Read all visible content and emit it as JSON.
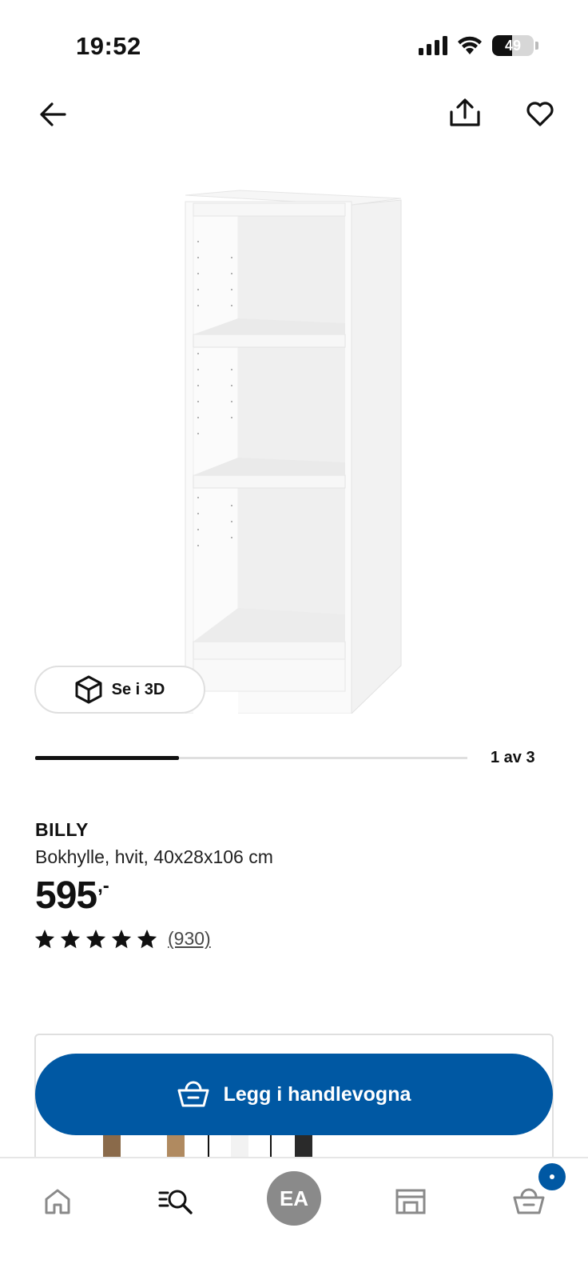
{
  "status_bar": {
    "time": "19:52",
    "battery_percent": "49",
    "battery_level": 0.49,
    "icons": [
      "signal-icon",
      "wifi-icon",
      "battery-icon"
    ]
  },
  "header": {
    "icons": [
      "back-arrow-icon",
      "share-icon",
      "heart-icon"
    ]
  },
  "gallery": {
    "view_3d_label": "Se i 3D",
    "view_3d_icon": "cube-icon",
    "position_label": "1 av 3",
    "current_index": 1,
    "total_images": 3
  },
  "product": {
    "name": "BILLY",
    "description": "Bokhylle, hvit, 40x28x106 cm",
    "price": "595",
    "price_suffix": ",-",
    "rating": 5,
    "rating_max": 5,
    "review_count": "(930)"
  },
  "cart_action": {
    "label": "Legg i handlevogna",
    "icon": "basket-icon"
  },
  "bottom_nav": {
    "items": [
      {
        "name": "home",
        "icon": "home-icon"
      },
      {
        "name": "search",
        "icon": "search-list-icon"
      },
      {
        "name": "profile",
        "label": "EA"
      },
      {
        "name": "store",
        "icon": "store-icon"
      },
      {
        "name": "cart",
        "icon": "basket-icon"
      }
    ]
  },
  "colors": {
    "brand_blue": "#0058a3",
    "text": "#111111",
    "avatar_gray": "#8a8a8a"
  }
}
